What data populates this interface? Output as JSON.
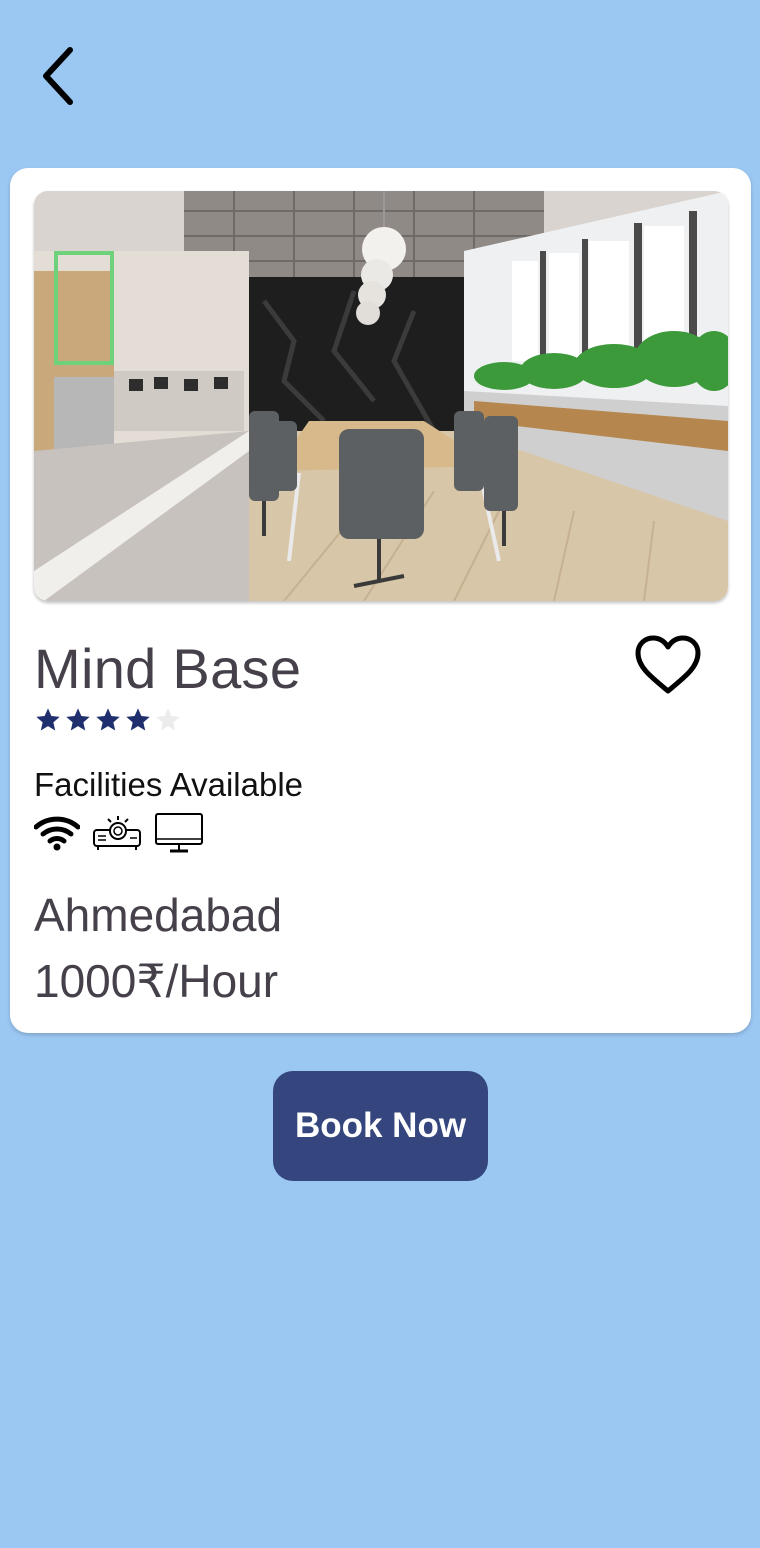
{
  "header": {
    "back_icon": "chevron-left-icon"
  },
  "venue": {
    "name": "Mind Base",
    "rating": {
      "value": 4,
      "max": 5,
      "filled_color": "#1f2f6e",
      "empty_color": "#ececec"
    },
    "facilities_label": "Facilities Available",
    "facilities": [
      {
        "icon": "wifi-icon"
      },
      {
        "icon": "projector-icon"
      },
      {
        "icon": "monitor-icon"
      }
    ],
    "city": "Ahmedabad",
    "price": "1000₹/Hour",
    "favorite_icon": "heart-outline-icon"
  },
  "actions": {
    "book_label": "Book Now"
  },
  "colors": {
    "background": "#9bc8f3",
    "button": "#34467d",
    "text": "#454049"
  }
}
